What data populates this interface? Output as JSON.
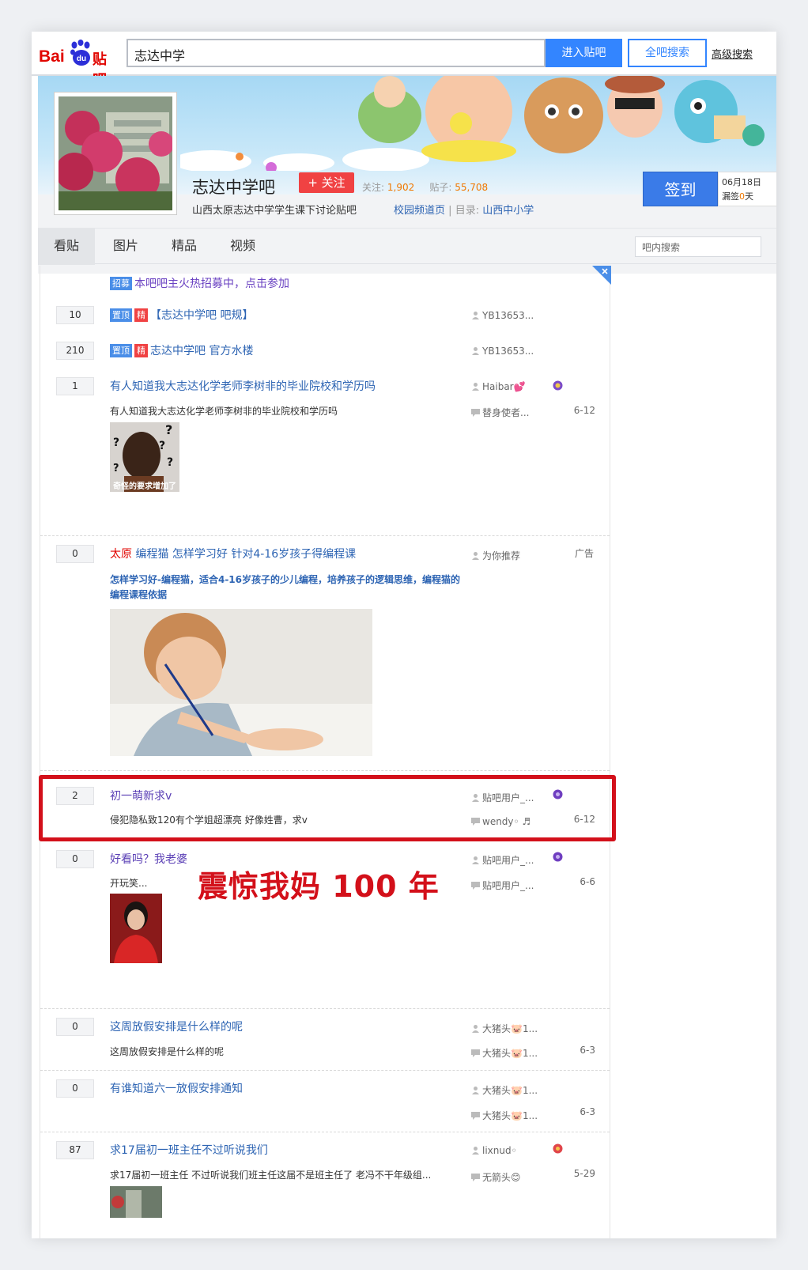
{
  "topbar": {
    "logo_bai": "Bai",
    "logo_du": "du",
    "logo_tieba": "贴吧",
    "search_value": "志达中学",
    "enter_label": "进入贴吧",
    "all_search_label": "全吧搜索",
    "advanced_label": "高级搜索"
  },
  "forum": {
    "name": "志达中学吧",
    "follow_label": "+ 关注",
    "followers_label": "关注:",
    "followers": "1,902",
    "posts_label": "贴子:",
    "posts": "55,708",
    "description": "山西太原志达中学学生课下讨论贴吧",
    "channel_link": "校园频道页",
    "separator": "|",
    "catalog_label": "目录:",
    "catalog_link": "山西中小学",
    "sign_label": "签到",
    "sign_date": "06月18日",
    "missed_prefix": "漏签",
    "missed_days": "0",
    "missed_suffix": "天"
  },
  "nav": {
    "tabs": [
      "看贴",
      "图片",
      "精品",
      "视频"
    ],
    "inner_search_placeholder": "吧内搜索"
  },
  "posts": [
    {
      "title": "本吧吧主火热招募中，点击参加",
      "tag": "招募"
    },
    {
      "count": "10",
      "tags": [
        "置顶",
        "精"
      ],
      "title": "【志达中学吧 吧规】",
      "author": "YB13653..."
    },
    {
      "count": "210",
      "tags": [
        "置顶",
        "精"
      ],
      "title": "志达中学吧 官方水楼",
      "author": "YB13653..."
    },
    {
      "count": "1",
      "title": "有人知道我大志达化学老师李树非的毕业院校和学历吗",
      "abstract": "有人知道我大志达化学老师李树非的毕业院校和学历吗",
      "author": "Haibar",
      "replier": "替身使者...",
      "date": "6-12",
      "image_caption": "奇怪的要求增加了"
    },
    {
      "count": "0",
      "city": "太原",
      "title": " 编程猫 怎样学习好 针对4-16岁孩子得编程课",
      "abstract": "怎样学习好-编程猫，适合4-16岁孩子的少儿编程，培养孩子的逻辑思维，编程猫的编程课程依据",
      "author": "为你推荐",
      "ad": "广告"
    },
    {
      "count": "2",
      "title": "初一萌新求v",
      "abstract": "侵犯隐私致120有个学姐超漂亮 好像姓曹，求v",
      "author": "贴吧用户_...",
      "replier": "wendy◦",
      "date": "6-12"
    },
    {
      "count": "0",
      "title": "好看吗？我老婆",
      "abstract": "开玩笑...",
      "author": "贴吧用户_...",
      "replier": "贴吧用户_...",
      "date": "6-6"
    },
    {
      "count": "0",
      "title": "这周放假安排是什么样的呢",
      "abstract": "这周放假安排是什么样的呢",
      "author": "大猪头🐷1...",
      "replier": "大猪头🐷1...",
      "date": "6-3"
    },
    {
      "count": "0",
      "title": "有谁知道六一放假安排通知",
      "author": "大猪头🐷1...",
      "replier": "大猪头🐷1...",
      "date": "6-3"
    },
    {
      "count": "87",
      "title": "求17届初一班主任不过听说我们",
      "abstract": "求17届初一班主任 不过听说我们班主任这届不是班主任了 老冯不干年级组...",
      "author": "lixnud◦",
      "replier": "无箭头😊",
      "date": "5-29"
    }
  ],
  "annotation": {
    "caption": "震惊我妈 100 年"
  },
  "colors": {
    "brand_red": "#e10601",
    "link_blue": "#2d64b3",
    "button_blue": "#3385ff",
    "highlight_red": "#d3101a"
  }
}
